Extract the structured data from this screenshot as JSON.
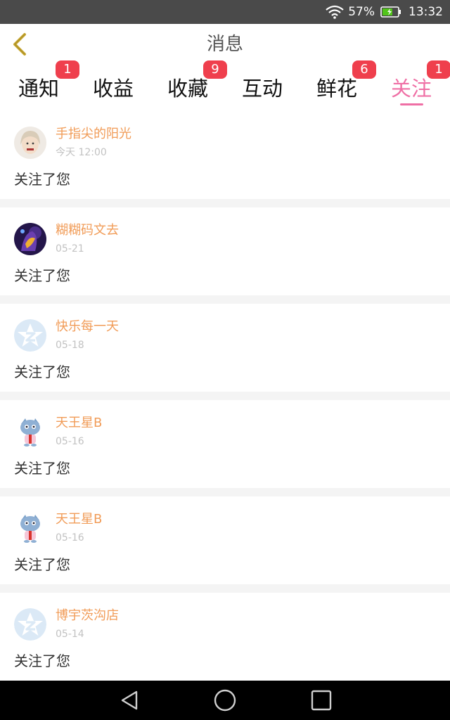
{
  "status_bar": {
    "battery_percent": "57%",
    "time": "13:32"
  },
  "header": {
    "title": "消息",
    "back_icon": "chevron-left-icon"
  },
  "tabs": [
    {
      "label": "通知",
      "badge": "1",
      "active": false
    },
    {
      "label": "收益",
      "badge": "",
      "active": false
    },
    {
      "label": "收藏",
      "badge": "9",
      "active": false
    },
    {
      "label": "互动",
      "badge": "",
      "active": false
    },
    {
      "label": "鲜花",
      "badge": "6",
      "active": false
    },
    {
      "label": "关注",
      "badge": "1",
      "active": true
    }
  ],
  "messages": [
    {
      "user": "手指尖的阳光",
      "time": "今天 12:00",
      "text": "关注了您",
      "avatar": "photo-avatar"
    },
    {
      "user": "糊糊码文去",
      "time": "05-21",
      "text": "关注了您",
      "avatar": "anime-avatar"
    },
    {
      "user": "快乐每一天",
      "time": "05-18",
      "text": "关注了您",
      "avatar": "default-star-avatar"
    },
    {
      "user": "天王星B",
      "time": "05-16",
      "text": "关注了您",
      "avatar": "penguin-avatar"
    },
    {
      "user": "天王星B",
      "time": "05-16",
      "text": "关注了您",
      "avatar": "penguin-avatar"
    },
    {
      "user": "博宇茨沟店",
      "time": "05-14",
      "text": "关注了您",
      "avatar": "default-star-avatar"
    }
  ],
  "colors": {
    "accent_pink": "#ef6fa5",
    "badge_red": "#ef3f4d",
    "username_orange": "#f19c58",
    "back_icon_gold": "#c8a830"
  },
  "nav_bar": {
    "icons": [
      "back-triangle-icon",
      "home-circle-icon",
      "recents-square-icon"
    ]
  }
}
